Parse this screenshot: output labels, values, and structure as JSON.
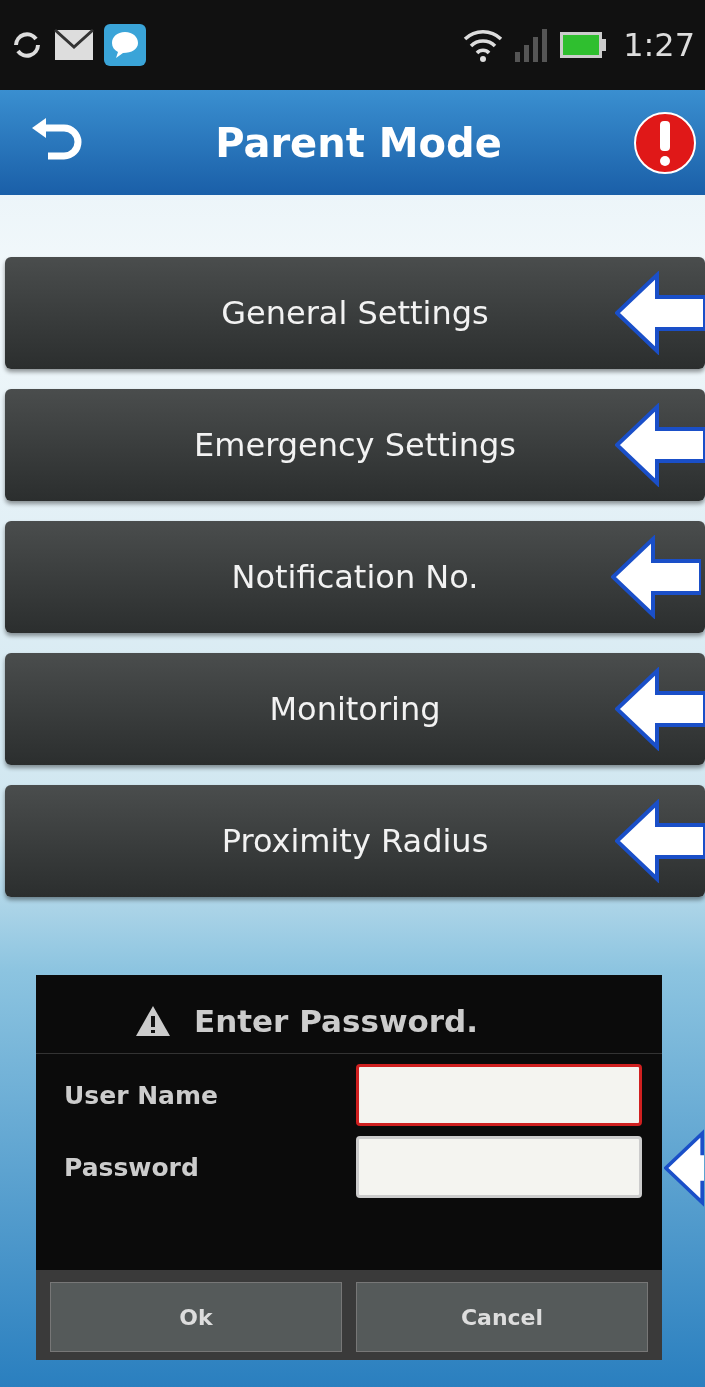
{
  "status_bar": {
    "time": "1:27"
  },
  "title_bar": {
    "title": "Parent Mode"
  },
  "menu": [
    {
      "label": "General Settings"
    },
    {
      "label": "Emergency Settings"
    },
    {
      "label": "Notification No."
    },
    {
      "label": "Monitoring"
    },
    {
      "label": "Proximity Radius"
    }
  ],
  "dialog": {
    "title": "Enter Password.",
    "fields": [
      {
        "label": "User Name",
        "focused": true
      },
      {
        "label": "Password",
        "focused": false
      }
    ],
    "buttons": [
      "Ok",
      "Cancel"
    ]
  }
}
